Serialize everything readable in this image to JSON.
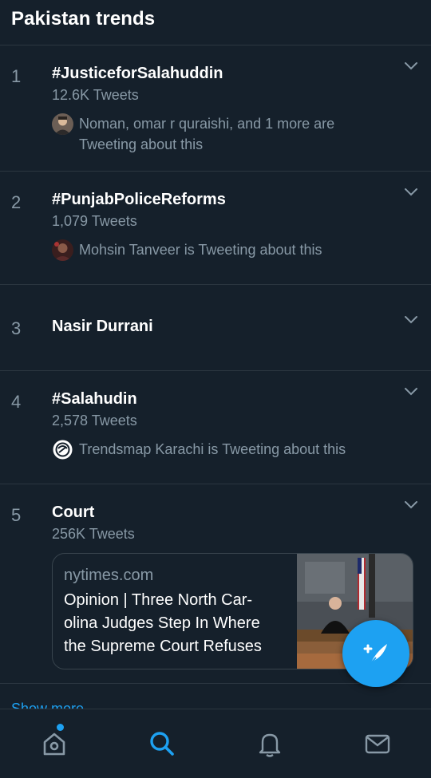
{
  "header": {
    "title": "Pakistan trends"
  },
  "trends": [
    {
      "rank": "1",
      "name": "#JusticeforSalahuddin",
      "count": "12.6K Tweets",
      "context": "Noman, omar r quraishi, and 1 more are Tweeting about this",
      "context_line1": "Noman, omar r quraishi, and 1 more are",
      "context_line2": "Tweeting about this"
    },
    {
      "rank": "2",
      "name": "#PunjabPoliceReforms",
      "count": "1,079 Tweets",
      "context": "Mohsin Tanveer is Tweeting about this"
    },
    {
      "rank": "3",
      "name": "Nasir Durrani"
    },
    {
      "rank": "4",
      "name": "#Salahudin",
      "count": "2,578 Tweets",
      "context": "Trendsmap Karachi is Tweeting about this"
    },
    {
      "rank": "5",
      "name": "Court",
      "count": "256K Tweets",
      "card": {
        "domain": "nytimes.com",
        "title_line1": "Opinion | Three North Car-",
        "title_line2": "olina Judges Step In Where",
        "title_line3": "the Supreme Court Refuses"
      }
    }
  ],
  "show_more": "Show more",
  "nav": {
    "items": [
      "home-icon",
      "search-icon",
      "notifications-icon",
      "messages-icon"
    ],
    "active": "search-icon"
  },
  "colors": {
    "background": "#15202b",
    "accent": "#1da1f2",
    "secondary_text": "#8899a6",
    "divider": "#2b3640"
  }
}
